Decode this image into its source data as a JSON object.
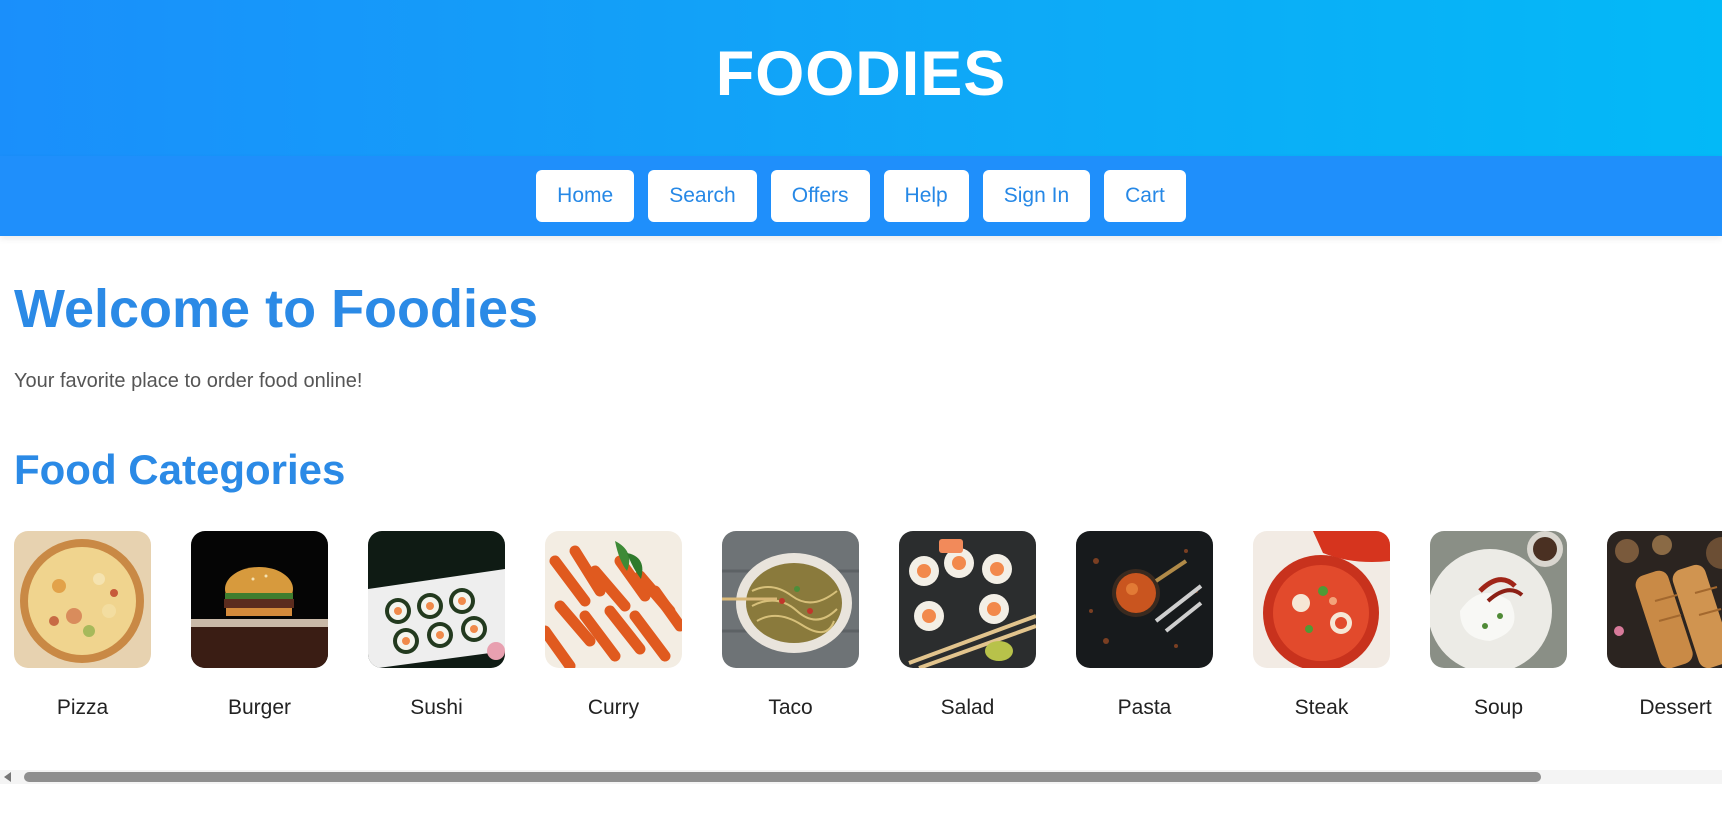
{
  "header": {
    "brand": "FOODIES"
  },
  "nav": {
    "items": [
      {
        "label": "Home"
      },
      {
        "label": "Search"
      },
      {
        "label": "Offers"
      },
      {
        "label": "Help"
      },
      {
        "label": "Sign In"
      },
      {
        "label": "Cart"
      }
    ]
  },
  "main": {
    "welcome": "Welcome to Foodies",
    "tagline": "Your favorite place to order food online!",
    "categories_title": "Food Categories",
    "categories": [
      {
        "label": "Pizza",
        "icon": "pizza-image"
      },
      {
        "label": "Burger",
        "icon": "burger-image"
      },
      {
        "label": "Sushi",
        "icon": "sushi-image"
      },
      {
        "label": "Curry",
        "icon": "curry-image"
      },
      {
        "label": "Taco",
        "icon": "taco-image"
      },
      {
        "label": "Salad",
        "icon": "salad-image"
      },
      {
        "label": "Pasta",
        "icon": "pasta-image"
      },
      {
        "label": "Steak",
        "icon": "steak-image"
      },
      {
        "label": "Soup",
        "icon": "soup-image"
      },
      {
        "label": "Dessert",
        "icon": "dessert-image"
      }
    ]
  },
  "colors": {
    "header_gradient_start": "#1a8ffb",
    "header_gradient_end": "#03b9f7",
    "nav_bg": "#1f8ffb",
    "accent_text": "#2b8ae6"
  }
}
